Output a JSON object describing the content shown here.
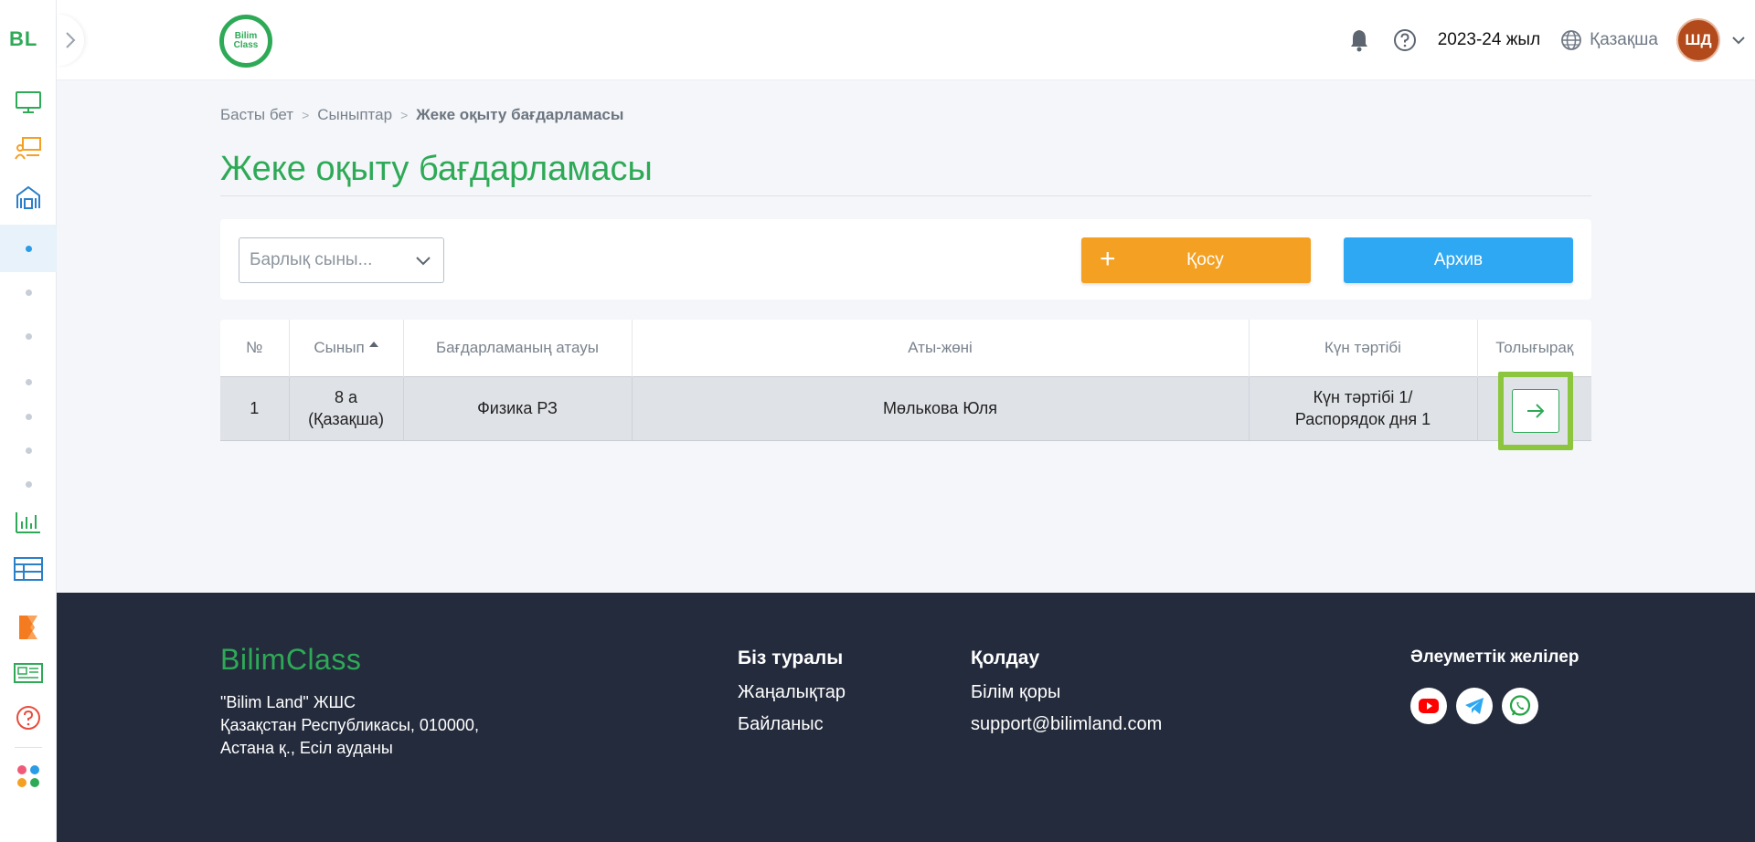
{
  "rail": {
    "logo": "BL",
    "toggle_icon": "chevron-right-icon",
    "items": [
      {
        "icon": "monitor-icon",
        "color": "#2eaa57"
      },
      {
        "icon": "teacher-board-icon",
        "color": "#f4a022"
      },
      {
        "icon": "school-icon",
        "color": "#2a7fc9"
      }
    ]
  },
  "header": {
    "logo_text": "Bilim Class",
    "year": "2023-24 жыл",
    "language": "Қазақша",
    "avatar_initials": "ШД"
  },
  "breadcrumb": {
    "items": [
      "Басты бет",
      "Сыныптар"
    ],
    "current": "Жеке оқыту бағдарламасы"
  },
  "page": {
    "title": "Жеке оқыту бағдарламасы"
  },
  "toolbar": {
    "class_select_value": "Барлық сыны...",
    "add_label": "Қосу",
    "archive_label": "Архив"
  },
  "table": {
    "headers": [
      "№",
      "Сынып",
      "Бағдарламаның атауы",
      "Аты-жөні",
      "Күн тәртібі",
      "Толығырақ"
    ],
    "rows": [
      {
        "num": "1",
        "class_line1": "8 а",
        "class_line2": "(Қазақша)",
        "program": "Физика РЗ",
        "name": "Мөлькова Юля",
        "schedule_line1": "Күн тәртібі 1/",
        "schedule_line2": "Распорядок дня 1"
      }
    ]
  },
  "footer": {
    "logo": "BilimClass",
    "address": [
      "\"Bilim Land\" ЖШС",
      "Қазақстан Республикасы, 010000,",
      "Астана қ., Есіл ауданы"
    ],
    "about": {
      "title": "Біз туралы",
      "links": [
        "Жаңалықтар",
        "Байланыс"
      ]
    },
    "support": {
      "title": "Қолдау",
      "links": [
        "Білім қоры",
        "support@bilimland.com"
      ]
    },
    "social": {
      "title": "Әлеуметтік желілер",
      "icons": [
        "youtube-icon",
        "telegram-icon",
        "whatsapp-icon"
      ]
    }
  },
  "colors": {
    "brand_green": "#2eaa57",
    "add_orange": "#f4a022",
    "archive_blue": "#2ea8f2",
    "highlight": "#8cc63f",
    "footer_bg": "#242b3c"
  }
}
